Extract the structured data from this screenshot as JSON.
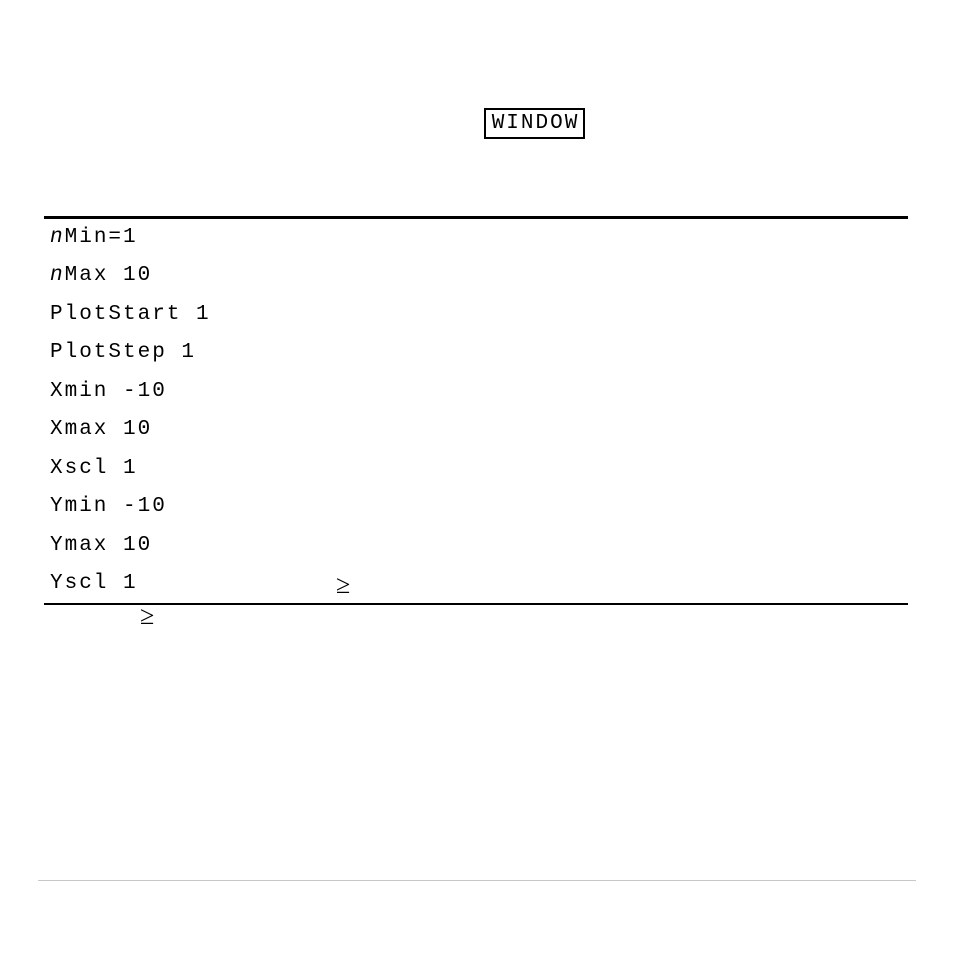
{
  "window_button_label": "WINDOW",
  "rows": [
    {
      "prefix_italic": "n",
      "rest": "Min=1"
    },
    {
      "prefix_italic": "n",
      "rest": "Max 10"
    },
    {
      "prefix_italic": "",
      "rest": "PlotStart 1"
    },
    {
      "prefix_italic": "",
      "rest": "PlotStep 1"
    },
    {
      "prefix_italic": "",
      "rest": "Xmin -10"
    },
    {
      "prefix_italic": "",
      "rest": "Xmax 10"
    },
    {
      "prefix_italic": "",
      "rest": "Xscl 1"
    },
    {
      "prefix_italic": "",
      "rest": "Ymin -10"
    },
    {
      "prefix_italic": "",
      "rest": "Ymax 10"
    },
    {
      "prefix_italic": "",
      "rest": "Yscl 1"
    }
  ],
  "geq_symbol_1": "≥",
  "geq_symbol_2": "≥"
}
